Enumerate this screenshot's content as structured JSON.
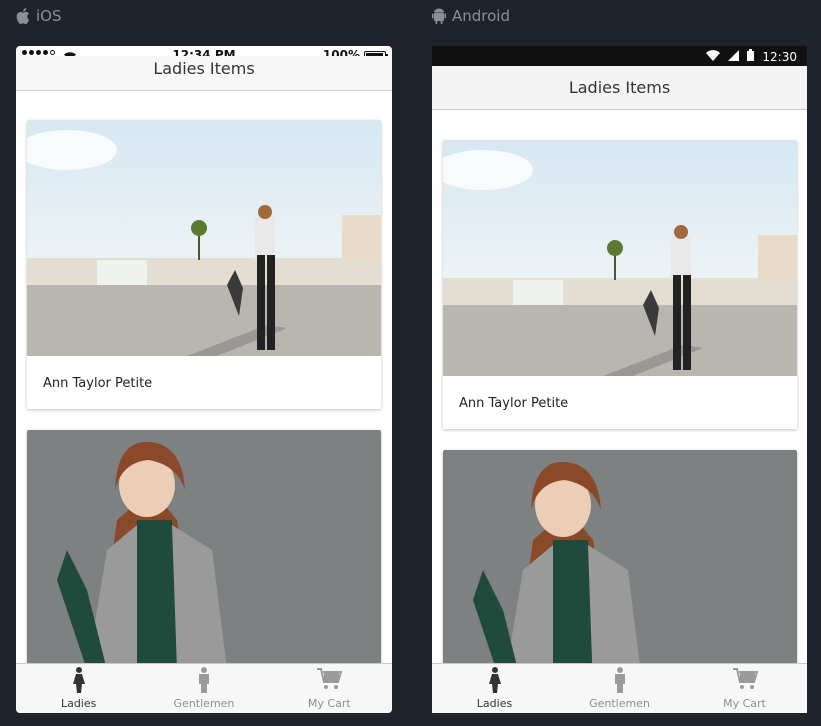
{
  "platforms": {
    "ios": "iOS",
    "android": "Android"
  },
  "ios": {
    "status": {
      "time": "12:34 PM",
      "battery": "100%"
    },
    "header_title": "Ladies Items"
  },
  "android": {
    "status": {
      "time": "12:30"
    },
    "header_title": "Ladies Items"
  },
  "cards": [
    {
      "title": "Ann Taylor Petite"
    },
    {
      "title": ""
    }
  ],
  "tabs": [
    {
      "label": "Ladies",
      "icon": "woman-icon",
      "active": true
    },
    {
      "label": "Gentlemen",
      "icon": "man-icon",
      "active": false
    },
    {
      "label": "My Cart",
      "icon": "cart-icon",
      "active": false
    }
  ],
  "colors": {
    "background": "#1f232b",
    "label": "#8a8f98"
  }
}
